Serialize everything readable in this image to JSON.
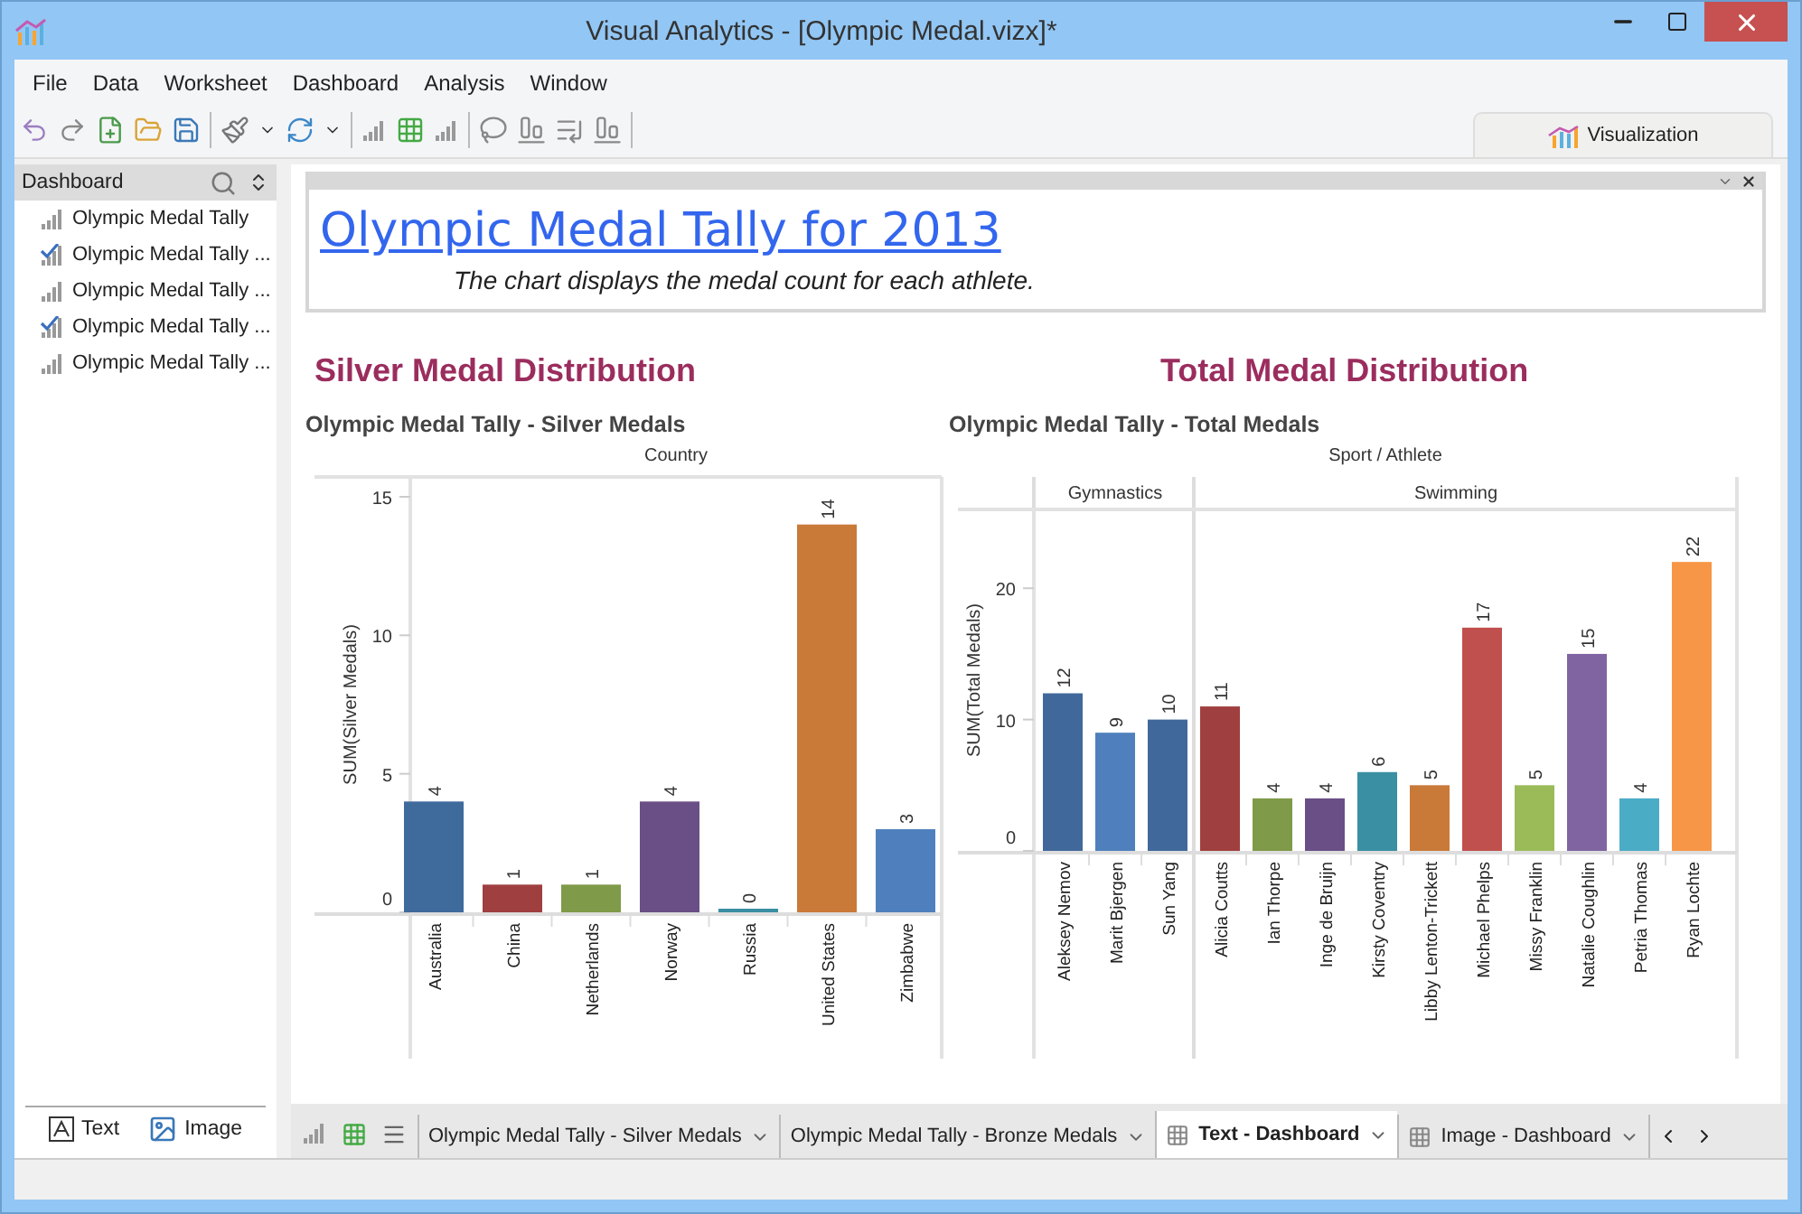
{
  "window": {
    "title": "Visual Analytics - [Olympic Medal.vizx]*"
  },
  "menu": [
    "File",
    "Data",
    "Worksheet",
    "Dashboard",
    "Analysis",
    "Window"
  ],
  "ribbon_tab": {
    "label": "Visualization",
    "selected": true
  },
  "sidebar": {
    "title": "Dashboard",
    "items": [
      {
        "label": "Olympic Medal Tally",
        "kind": "chart"
      },
      {
        "label": "Olympic Medal Tally ...",
        "kind": "checked"
      },
      {
        "label": "Olympic Medal Tally ...",
        "kind": "chart"
      },
      {
        "label": "Olympic Medal Tally ...",
        "kind": "checked"
      },
      {
        "label": "Olympic Medal Tally ...",
        "kind": "chart"
      }
    ],
    "objects": [
      {
        "label": "Text",
        "kind": "text"
      },
      {
        "label": "Image",
        "kind": "image"
      }
    ]
  },
  "text_panel": {
    "title": "Olympic Medal Tally for 2013",
    "subtitle": "The chart displays the medal count for each athlete."
  },
  "sections": [
    {
      "heading": "Silver Medal Distribution",
      "chart_title": "Olympic Medal Tally - Silver Medals",
      "chart_data": {
        "type": "bar",
        "xlabel": "Country",
        "ylabel": "SUM(Silver Medals)",
        "categories": [
          "Australia",
          "China",
          "Netherlands",
          "Norway",
          "Russia",
          "United States",
          "Zimbabwe"
        ],
        "values": [
          4,
          1,
          1,
          4,
          0,
          14,
          3
        ],
        "colors": [
          "#3f6a9c",
          "#a03f3f",
          "#7f9a48",
          "#6a4f86",
          "#3a8fa3",
          "#c97a39",
          "#4f80bd"
        ],
        "ylim": [
          0,
          15
        ],
        "yticks": [
          0,
          5,
          10,
          15
        ],
        "data_labels": true
      }
    },
    {
      "heading": "Total Medal Distribution",
      "chart_title": "Olympic Medal Tally - Total Medals",
      "groups": [
        {
          "label": "Gymnastics",
          "members": [
            "Aleksey Nemov",
            "Marit Bjergen",
            "Sun Yang"
          ]
        },
        {
          "label": "Swimming",
          "members": [
            "Alicia Coutts",
            "Ian Thorpe",
            "Inge de Bruijn",
            "Kirsty Coventry",
            "Libby Lenton-Trickett",
            "Michael Phelps",
            "Missy Franklin",
            "Natalie Coughlin",
            "Petria Thomas",
            "Ryan Lochte"
          ]
        }
      ],
      "chart_data": {
        "type": "bar",
        "xlabel": "Sport / Athlete",
        "ylabel": "SUM(Total Medals)",
        "values": [
          12,
          9,
          10,
          11,
          4,
          4,
          6,
          5,
          17,
          5,
          15,
          4,
          22
        ],
        "colors": [
          "#41689a",
          "#4f80bd",
          "#41689a",
          "#a03f3f",
          "#7f9a48",
          "#6a4f86",
          "#3a8fa3",
          "#c97a39",
          "#c0504d",
          "#9bbb59",
          "#8064a2",
          "#4bacc6",
          "#f79646"
        ],
        "ylim": [
          0,
          26
        ],
        "yticks": [
          0,
          10,
          20
        ],
        "data_labels": true
      }
    }
  ],
  "sheet_tabs": [
    {
      "label": "Olympic Medal Tally - Silver Medals",
      "kind": "sheet",
      "selected": false
    },
    {
      "label": "Olympic Medal Tally - Bronze Medals",
      "kind": "sheet",
      "selected": false
    },
    {
      "label": "Text - Dashboard",
      "kind": "dashboard",
      "selected": true
    },
    {
      "label": "Image - Dashboard",
      "kind": "dashboard",
      "selected": false
    }
  ]
}
